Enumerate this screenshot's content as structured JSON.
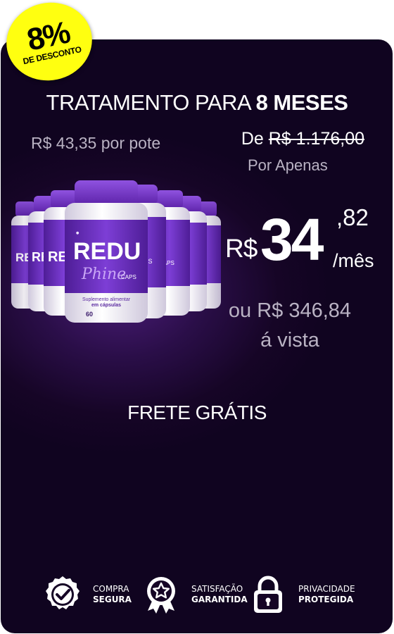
{
  "badge": {
    "percent": "8%",
    "label": "DE DESCONTO"
  },
  "offer": {
    "title_prefix": "TRATAMENTO PARA ",
    "title_highlight": "8 MESES",
    "per_pot": "R$ 43,35 por pote",
    "old_prefix": "De ",
    "old_price": "R$ 1.176,00",
    "por_apenas": "Por Apenas",
    "currency": "R$",
    "price_int": "34",
    "price_dec": ",82",
    "per_month": "/mês",
    "total_line1": "ou R$ 346,84",
    "total_line2": "á vista",
    "shipping": "FRETE GRÁTIS"
  },
  "product": {
    "brand_line1": "REDU",
    "brand_line2": "Phine",
    "brand_caps": "CAPS",
    "jar_count": "60",
    "supplement_line1": "Suplemento alimentar",
    "supplement_line2": "em cápsulas",
    "colors": {
      "cap": "#7a3bd0",
      "label": "#6b2fc0",
      "body": "#f2f0f6"
    }
  },
  "trust": [
    {
      "icon": "shield-check-icon",
      "line1": "COMPRA",
      "line2": "SEGURA"
    },
    {
      "icon": "award-badge-icon",
      "line1": "SATISFAÇÃO",
      "line2": "GARANTIDA"
    },
    {
      "icon": "padlock-icon",
      "line1": "PRIVACIDADE",
      "line2": "PROTEGIDA"
    }
  ],
  "colors": {
    "badge": "#ffff10",
    "card": "#160526",
    "glow": "#4a1c78",
    "muted_text": "#b9b2c3"
  }
}
